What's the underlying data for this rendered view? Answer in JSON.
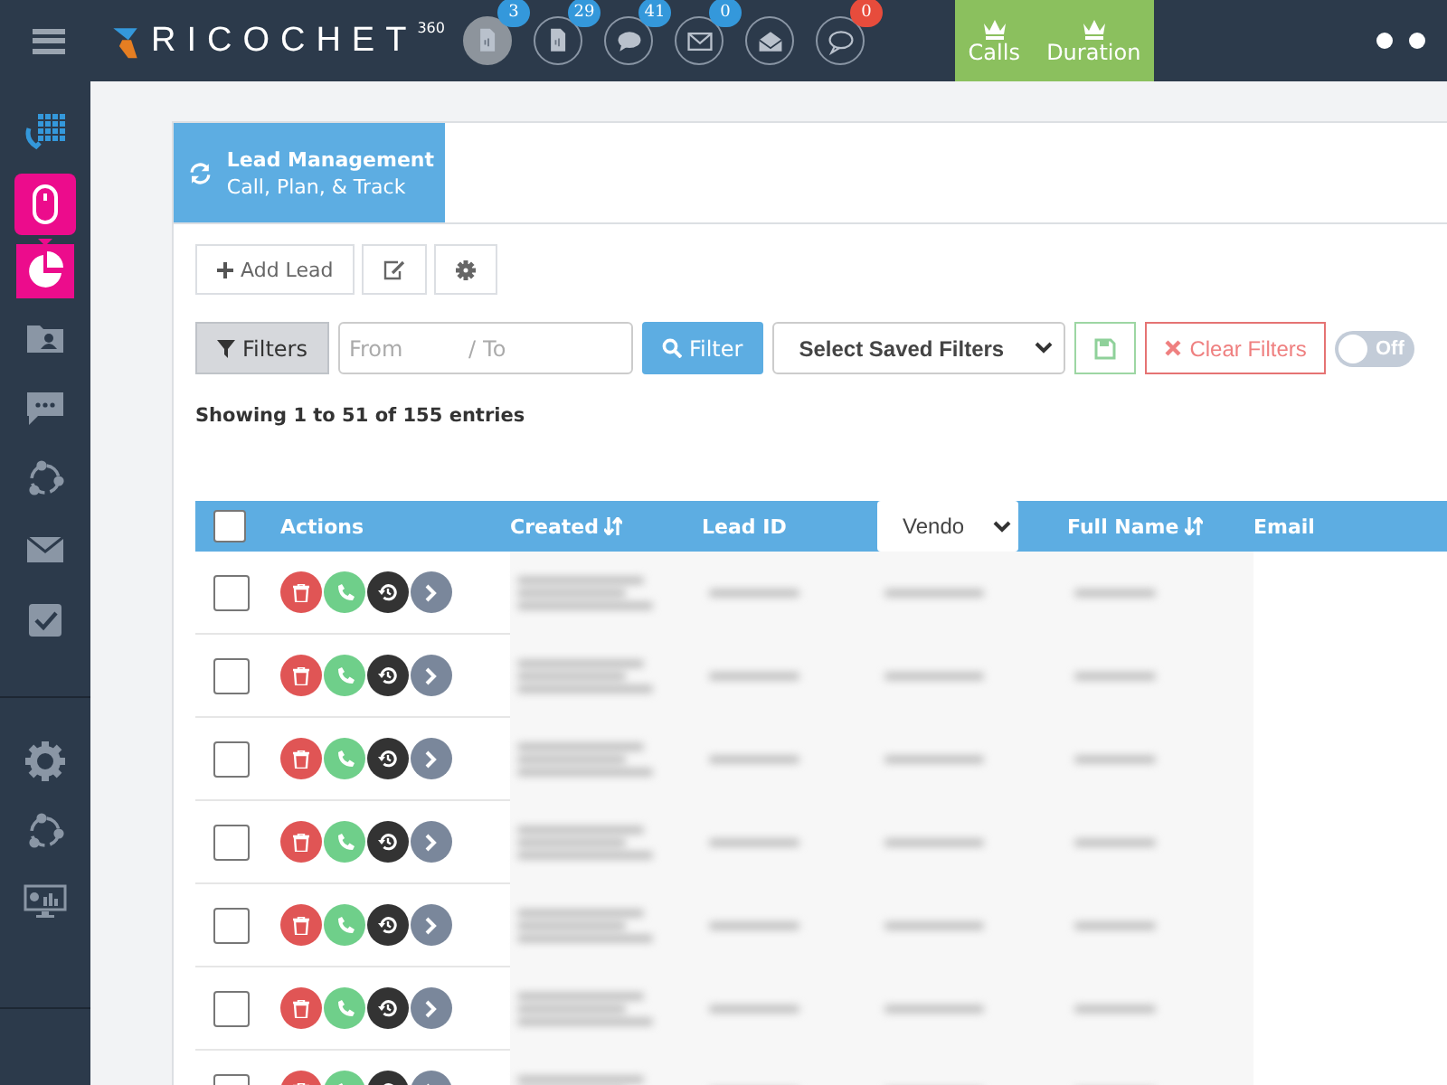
{
  "topbar": {
    "brand": "RICOCHET",
    "brand_sup": "360",
    "counters": [
      {
        "kind": "voicemail",
        "count": "3",
        "selected": true,
        "color": "#3498db"
      },
      {
        "kind": "voicemail",
        "count": "29",
        "selected": false,
        "color": "#3498db"
      },
      {
        "kind": "chat",
        "count": "41",
        "selected": false,
        "color": "#3498db"
      },
      {
        "kind": "mail",
        "count": "0",
        "selected": false,
        "color": "#3498db"
      },
      {
        "kind": "open-mail",
        "selected": false
      },
      {
        "kind": "comment",
        "count": "0",
        "selected": false,
        "color": "#e74c3c"
      }
    ],
    "leaders": [
      "Calls",
      "Duration"
    ]
  },
  "sidebar": {
    "items": [
      {
        "kind": "dialpad"
      },
      {
        "kind": "mouse",
        "selected": true
      },
      {
        "kind": "pie",
        "selected": true
      },
      {
        "kind": "contacts",
        "selected": false
      },
      {
        "kind": "chat",
        "selected": false
      },
      {
        "kind": "share",
        "selected": false
      },
      {
        "kind": "mail",
        "selected": false
      },
      {
        "kind": "task",
        "selected": false
      },
      {
        "kind": "divider"
      },
      {
        "kind": "gear",
        "selected": false
      },
      {
        "kind": "share",
        "selected": false
      },
      {
        "kind": "monitor",
        "selected": false
      }
    ]
  },
  "tab": {
    "title": "Lead Management",
    "subtitle": "Call, Plan, & Track"
  },
  "toolbar": {
    "add_label": "Add Lead"
  },
  "filters": {
    "filters_label": "Filters",
    "from_placeholder": "From",
    "separator": "/",
    "to_placeholder": "To",
    "filter_button": "Filter",
    "saved_filters": "Select Saved Filters",
    "clear_button": "Clear Filters",
    "toggle": {
      "label": "Off",
      "on": false
    }
  },
  "summary": "Showing 1 to 51 of 155 entries",
  "table": {
    "columns": [
      {
        "kind": "check",
        "checked": false
      },
      {
        "kind": "text",
        "label": "Actions"
      },
      {
        "kind": "sort",
        "label": "Created"
      },
      {
        "kind": "text",
        "label": "Lead ID"
      },
      {
        "kind": "select",
        "label": "Vendo"
      },
      {
        "kind": "sort",
        "label": "Full Name"
      },
      {
        "kind": "text",
        "label": "Email"
      }
    ],
    "rows": [
      {
        "checked": false
      },
      {
        "checked": false
      },
      {
        "checked": false
      },
      {
        "checked": false
      },
      {
        "checked": false
      },
      {
        "checked": false
      },
      {
        "checked": false
      }
    ]
  }
}
